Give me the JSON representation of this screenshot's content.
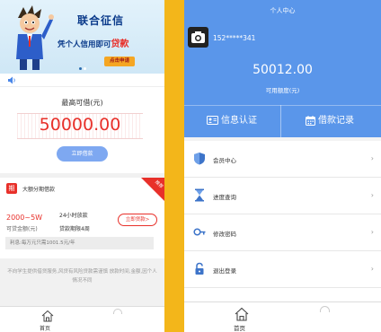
{
  "left": {
    "banner": {
      "headline": "联合征信",
      "subline_prefix": "凭个人信用即可",
      "subline_highlight": "贷款",
      "cta": "点击申请"
    },
    "amount": {
      "label": "最高可借(元)",
      "value": "50000.00",
      "button": "立即借款"
    },
    "product": {
      "logo_char": "期",
      "name": "大额分期借款",
      "ribbon": "推荐",
      "range": "2000~5W",
      "range_label": "可贷金额(元)",
      "feature_1": "24小时放款",
      "feature_2": "贷款期限4周",
      "apply": "立即贷款>",
      "rate": "利息:每万元只需1001.5元/年"
    },
    "disclaimer": "不向学生提供借贷服务,风贷有风险贷款需谨慎 放款时间,金额,因个人情况不同",
    "tabbar": {
      "home": "首页"
    }
  },
  "right": {
    "title": "个人中心",
    "phone": "152*****341",
    "balance": "50012.00",
    "balance_label": "可用额度(元)",
    "tabs": [
      {
        "label": "信息认证",
        "icon": "id-card-icon"
      },
      {
        "label": "借款记录",
        "icon": "calendar-icon"
      }
    ],
    "menu": [
      {
        "label": "会员中心",
        "icon": "shield-icon"
      },
      {
        "label": "进度查询",
        "icon": "hourglass-icon"
      },
      {
        "label": "修改密码",
        "icon": "key-icon"
      },
      {
        "label": "退出登录",
        "icon": "lock-icon"
      }
    ],
    "tabbar": {
      "home": "首页"
    }
  },
  "colors": {
    "accent_blue": "#5a96ea",
    "button_blue": "#7ea8f1",
    "red": "#e8302a",
    "divider_yellow": "#f3b61a"
  }
}
